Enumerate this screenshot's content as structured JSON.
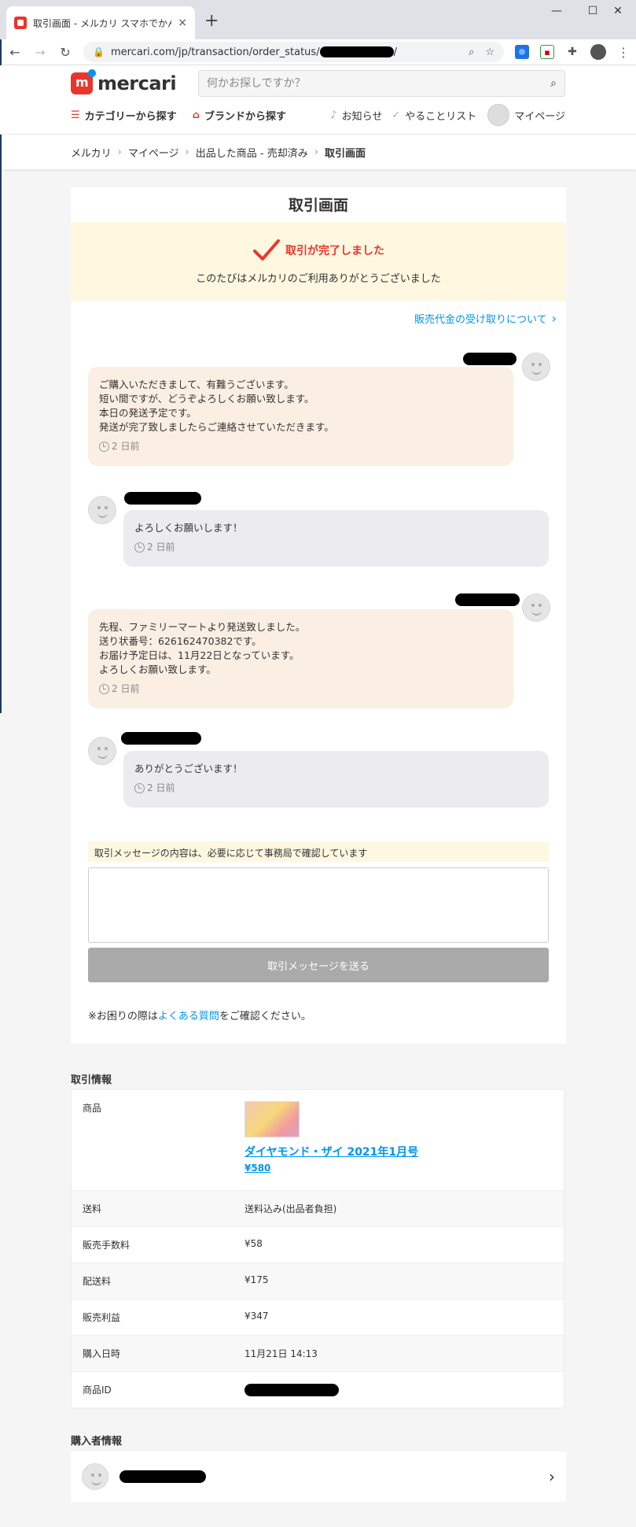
{
  "browser": {
    "tab_title": "取引画面 - メルカリ スマホでかんたん",
    "tab_close": "×",
    "new_tab": "+",
    "url_prefix": "mercari.com/jp/transaction/order_status/",
    "url_suffix": "/",
    "back": "←",
    "forward": "→",
    "reload": "↻",
    "minimize": "—",
    "maximize": "☐",
    "close": "✕"
  },
  "header": {
    "logo_text": "mercari",
    "search_placeholder": "何かお探しですか？",
    "category_label": "カテゴリーから探す",
    "brand_label": "ブランドから探す",
    "notifications_label": "お知らせ",
    "todo_label": "やることリスト",
    "mypage_label": "マイページ"
  },
  "breadcrumb": {
    "items": [
      "メルカリ",
      "マイページ",
      "出品した商品 - 売却済み",
      "取引画面"
    ],
    "separator": "›"
  },
  "main": {
    "title": "取引画面",
    "done_title": "取引が完了しました",
    "done_sub": "このたびはメルカリのご利用ありがとうございました",
    "payout_link": "販売代金の受け取りについて",
    "messages": [
      {
        "role": "seller",
        "text": "ご購入いただきまして、有難うございます。\n短い間ですが、どうぞよろしくお願い致します。\n本日の発送予定です。\n発送が完了致しましたらご連絡させていただきます。",
        "time": "2 日前"
      },
      {
        "role": "buyer",
        "text": "よろしくお願いします！",
        "time": "2 日前"
      },
      {
        "role": "seller",
        "text": "先程、ファミリーマートより発送致しました。\n送り状番号：626162470382です。\nお届け予定日は、11月22日となっています。\nよろしくお願い致します。",
        "time": "2 日前"
      },
      {
        "role": "buyer",
        "text": "ありがとうございます！",
        "time": "2 日前"
      }
    ],
    "notice": "取引メッセージの内容は、必要に応じて事務局で確認しています",
    "message_value": "",
    "send_button": "取引メッセージを送る",
    "help_prefix": "※お困りの際は",
    "help_link": "よくある質問",
    "help_suffix": "をご確認ください。"
  },
  "transaction": {
    "title": "取引情報",
    "rows": [
      {
        "label": "商品",
        "item_name": "ダイヤモンド・ザイ 2021年1月号",
        "item_price": "¥580"
      },
      {
        "label": "送料",
        "value": "送料込み(出品者負担)"
      },
      {
        "label": "販売手数料",
        "value": "¥58"
      },
      {
        "label": "配送料",
        "value": "¥175"
      },
      {
        "label": "販売利益",
        "value": "¥347"
      },
      {
        "label": "購入日時",
        "value": "11月21日 14:13"
      },
      {
        "label": "商品ID",
        "value": ""
      }
    ]
  },
  "buyer": {
    "title": "購入者情報",
    "arrow": "›"
  },
  "colors": {
    "brand_red": "#ea352d",
    "link_blue": "#0095ee",
    "seller_bubble": "#fbefe3",
    "buyer_bubble": "#ececef",
    "notice_bg": "#fff7e0"
  }
}
